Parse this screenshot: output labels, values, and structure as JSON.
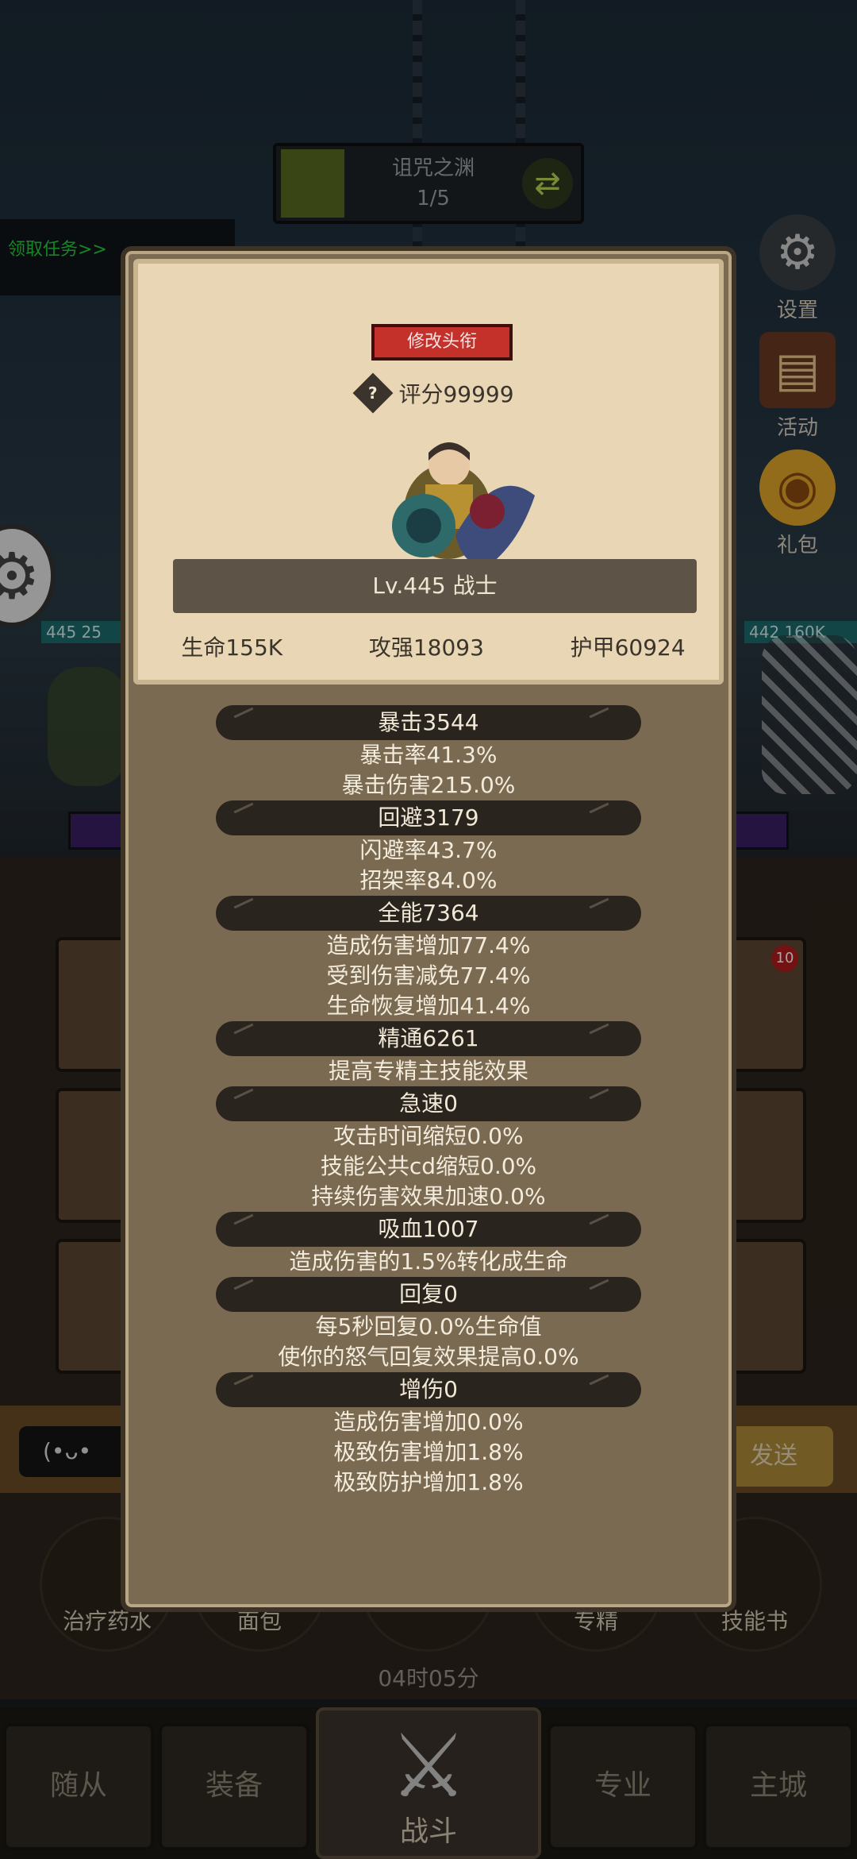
{
  "hud": {
    "stage_title": "诅咒之渊",
    "stage_progress": "1/5",
    "quest_tab": "领取任务>>",
    "settings_label": "设置",
    "events_label": "活动",
    "gift_label": "礼包",
    "left_hp": "25",
    "left_level": "445",
    "right_level": "442",
    "right_hp": "160K",
    "chat_emote": "(•ᴗ•",
    "send_label": "发送",
    "slot_badge": "10",
    "timer": "04时05分"
  },
  "items": [
    {
      "label": "治疗药水"
    },
    {
      "label": "面包"
    },
    {
      "label": ""
    },
    {
      "label": "专精"
    },
    {
      "label": "技能书"
    }
  ],
  "nav": {
    "followers": "随从",
    "equipment": "装备",
    "battle": "战斗",
    "profession": "专业",
    "city": "主城"
  },
  "profile": {
    "rename_button": "修改头衔",
    "help_glyph": "?",
    "score": "评分99999",
    "level_class": "Lv.445 战士",
    "hp": "生命155K",
    "attack": "攻强18093",
    "armor": "护甲60924"
  },
  "stats": [
    {
      "head": "暴击3544",
      "lines": [
        "暴击率41.3%",
        "暴击伤害215.0%"
      ]
    },
    {
      "head": "回避3179",
      "lines": [
        "闪避率43.7%",
        "招架率84.0%"
      ]
    },
    {
      "head": "全能7364",
      "lines": [
        "造成伤害增加77.4%",
        "受到伤害减免77.4%",
        "生命恢复增加41.4%"
      ]
    },
    {
      "head": "精通6261",
      "lines": [
        "提高专精主技能效果"
      ]
    },
    {
      "head": "急速0",
      "lines": [
        "攻击时间缩短0.0%",
        "技能公共cd缩短0.0%",
        "持续伤害效果加速0.0%"
      ]
    },
    {
      "head": "吸血1007",
      "lines": [
        "造成伤害的1.5%转化成生命"
      ]
    },
    {
      "head": "回复0",
      "lines": [
        "每5秒回复0.0%生命值",
        "使你的怒气回复效果提高0.0%"
      ]
    },
    {
      "head": "增伤0",
      "lines": [
        "造成伤害增加0.0%",
        "极致伤害增加1.8%",
        "极致防护增加1.8%"
      ]
    }
  ]
}
